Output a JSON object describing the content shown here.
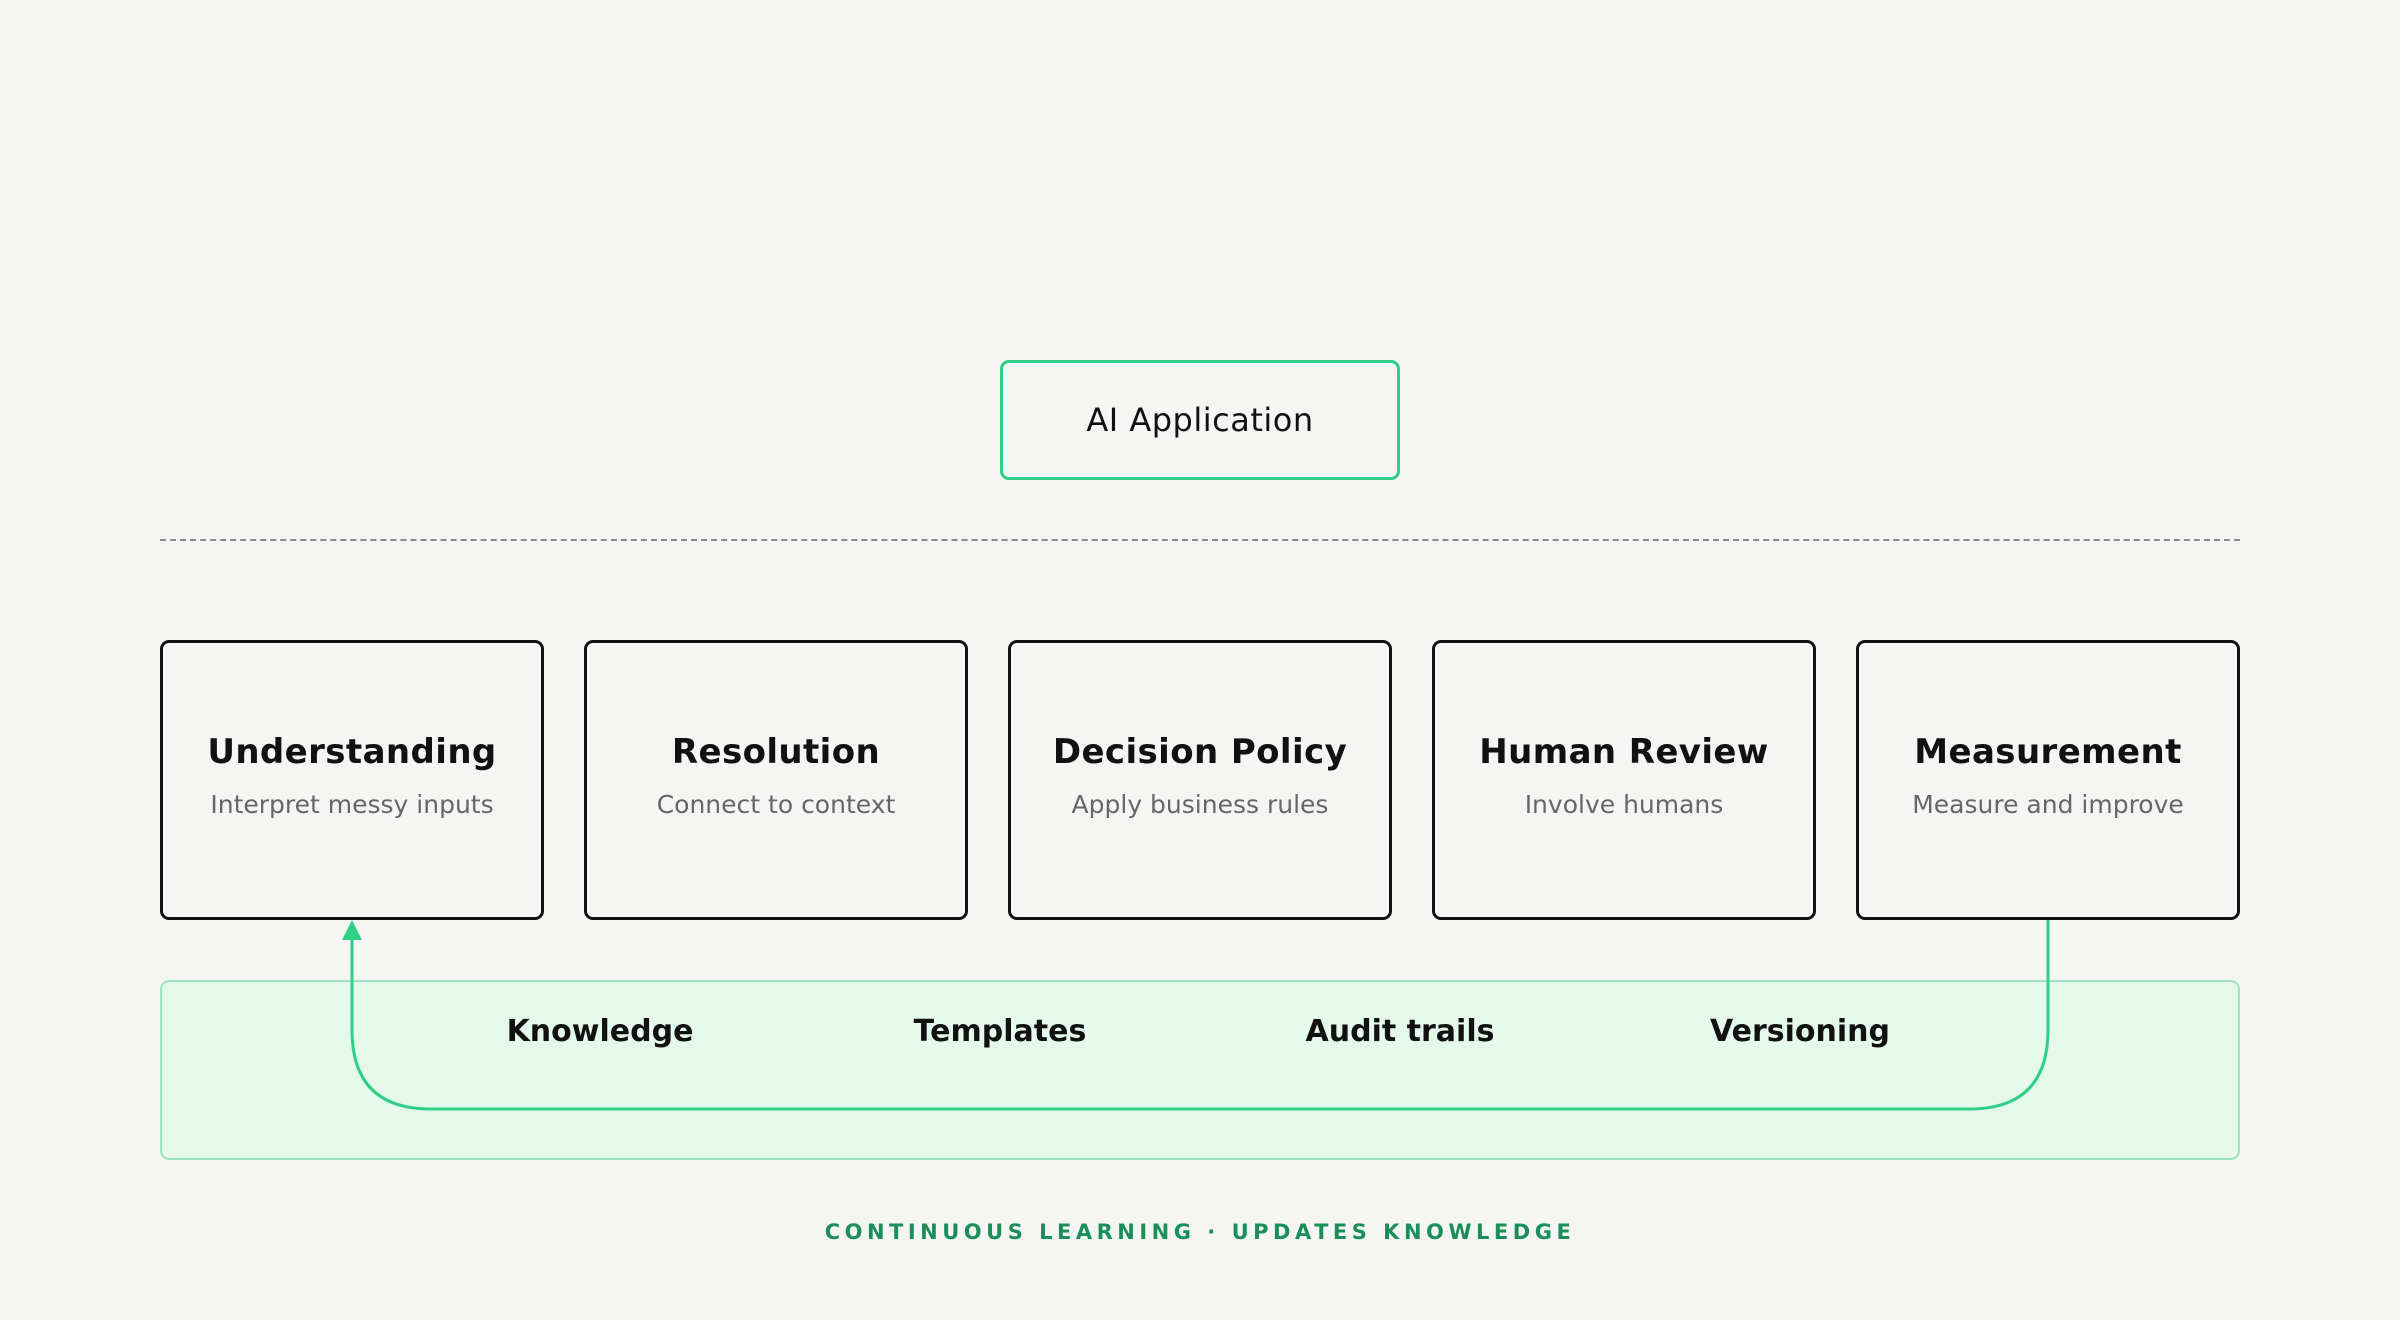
{
  "app": {
    "label": "AI Application"
  },
  "stages": [
    {
      "title": "Understanding",
      "desc": "Interpret messy inputs"
    },
    {
      "title": "Resolution",
      "desc": "Connect to context"
    },
    {
      "title": "Decision Policy",
      "desc": "Apply business rules"
    },
    {
      "title": "Human Review",
      "desc": "Involve humans"
    },
    {
      "title": "Measurement",
      "desc": "Measure and improve"
    }
  ],
  "foundation": {
    "items": [
      "Knowledge",
      "Templates",
      "Audit trails",
      "Versioning"
    ]
  },
  "loop": {
    "caption": "CONTINUOUS LEARNING · UPDATES KNOWLEDGE",
    "from": "Measurement",
    "to": "Understanding"
  },
  "colors": {
    "accent": "#2fcf85",
    "caption": "#1b8f5a",
    "foundation_fill": "#e4f8ec",
    "foundation_border": "#9fe3c2",
    "box_border": "#111111",
    "background": "#f5f6f4"
  }
}
